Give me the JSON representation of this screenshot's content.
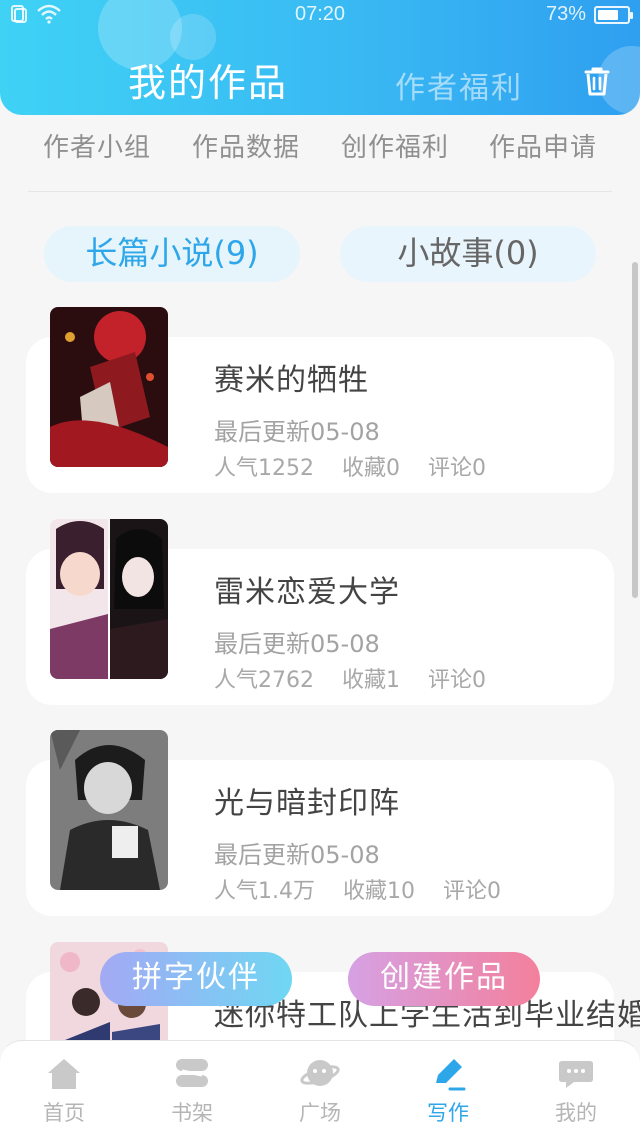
{
  "status_bar": {
    "time": "07:20",
    "battery": "73%",
    "battery_level": 0.73
  },
  "header": {
    "title": "我的作品",
    "welfare": "作者福利",
    "delete_icon": "trash-icon"
  },
  "sub_nav": [
    "作者小组",
    "作品数据",
    "创作福利",
    "作品申请"
  ],
  "tabs": {
    "long_novel": "长篇小说(9)",
    "short_story": "小故事(0)"
  },
  "works": [
    {
      "title": "赛米的牺牲",
      "updated": "最后更新05-08",
      "popularity": "人气1252",
      "favorites": "收藏0",
      "comments": "评论0"
    },
    {
      "title": "雷米恋爱大学",
      "updated": "最后更新05-08",
      "popularity": "人气2762",
      "favorites": "收藏1",
      "comments": "评论0"
    },
    {
      "title": "光与暗封印阵",
      "updated": "最后更新05-08",
      "popularity": "人气1.4万",
      "favorites": "收藏10",
      "comments": "评论0"
    },
    {
      "title": "迷你特工队上学生活到毕业结婚",
      "updated": "",
      "popularity": "",
      "favorites": "",
      "comments": ""
    }
  ],
  "floating_buttons": {
    "partner": "拼字伙伴",
    "create": "创建作品"
  },
  "bottom_nav": [
    {
      "label": "首页",
      "icon": "home-icon"
    },
    {
      "label": "书架",
      "icon": "bookshelf-icon"
    },
    {
      "label": "广场",
      "icon": "planet-icon"
    },
    {
      "label": "写作",
      "icon": "pen-icon"
    },
    {
      "label": "我的",
      "icon": "chat-bubble-icon"
    }
  ],
  "colors": {
    "accent": "#2ea7ea",
    "header_start": "#3fd2f5",
    "header_end": "#2f9ff0",
    "create_start": "#d6a1e4",
    "create_end": "#f3809c"
  }
}
